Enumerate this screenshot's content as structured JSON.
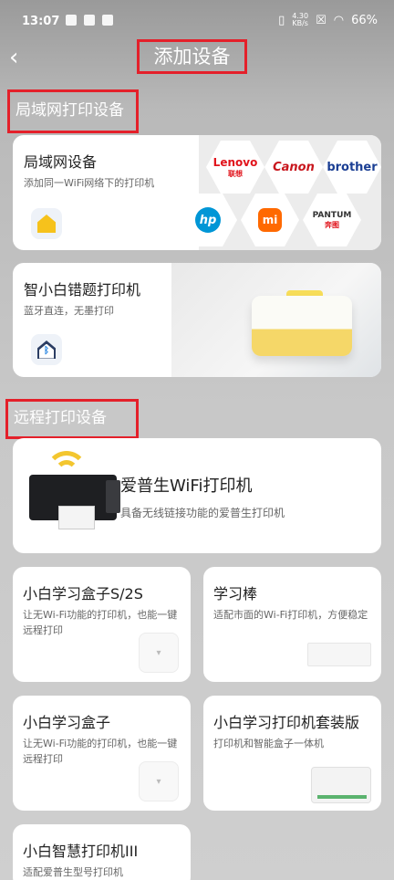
{
  "status_bar": {
    "time": "13:07",
    "net_speed": "4.30",
    "net_unit": "KB/s",
    "battery": "66%"
  },
  "header": {
    "title": "添加设备"
  },
  "sections": {
    "lan": "局域网打印设备",
    "remote": "远程打印设备"
  },
  "cards": {
    "lan_device": {
      "title": "局域网设备",
      "desc": "添加同一WiFi网络下的打印机",
      "brands": [
        "Lenovo",
        "联想",
        "Canon",
        "brother",
        "hp",
        "mi",
        "PANTUM",
        "奔图"
      ]
    },
    "error_printer": {
      "title": "智小白错题打印机",
      "desc": "蓝牙直连，无墨打印"
    },
    "epson": {
      "title": "爱普生WiFi打印机",
      "desc": "具备无线链接功能的爱普生打印机"
    },
    "box_s2": {
      "title": "小白学习盒子S/2S",
      "desc": "让无Wi-Fi功能的打印机，也能一键远程打印"
    },
    "study_rod": {
      "title": "学习棒",
      "desc": "适配市面的Wi-Fi打印机，方便稳定"
    },
    "study_box": {
      "title": "小白学习盒子",
      "desc": "让无Wi-Fi功能的打印机，也能一键远程打印"
    },
    "printer_suite": {
      "title": "小白学习打印机套装版",
      "desc": "打印机和智能盒子一体机"
    },
    "smart_printer": {
      "title": "小白智慧打印机III",
      "desc": "适配爱普生型号打印机"
    }
  },
  "colors": {
    "highlight_border": "#e4202a",
    "accent_yellow": "#f6c21c"
  }
}
